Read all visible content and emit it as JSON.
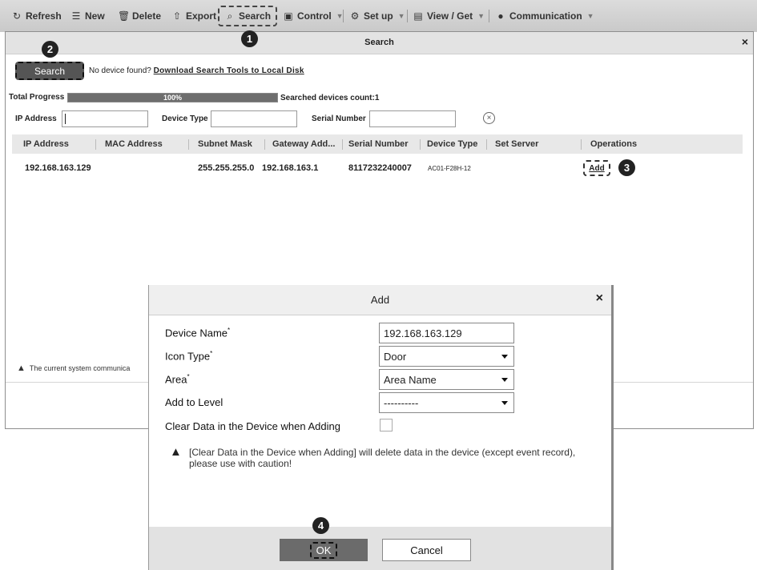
{
  "toolbar": {
    "refresh": "Refresh",
    "new": "New",
    "delete": "Delete",
    "export": "Export",
    "search": "Search",
    "control": "Control",
    "setup": "Set up",
    "view_get": "View / Get",
    "communication": "Communication"
  },
  "markers": [
    "1",
    "2",
    "3",
    "4"
  ],
  "search_window": {
    "title": "Search",
    "close": "×",
    "search_button": "Search",
    "no_device_text": "No device found?",
    "download_link": "Download Search Tools to Local Disk",
    "total_progress_label": "Total Progress",
    "progress_text": "100%",
    "progress_value": 1.0,
    "count_label": "Searched devices count:1",
    "filters": {
      "ip_label": "IP Address",
      "device_type_label": "Device Type",
      "serial_label": "Serial Number"
    },
    "columns": [
      "IP Address",
      "MAC Address",
      "Subnet Mask",
      "Gateway Add...",
      "Serial Number",
      "Device Type",
      "Set Server",
      "Operations"
    ],
    "row": {
      "ip": "192.168.163.129",
      "mac": "",
      "subnet": "255.255.255.0",
      "gateway": "192.168.163.1",
      "serial": "8117232240007",
      "device_type": "AC01-F28H-12",
      "set_server": "",
      "operation": "Add"
    },
    "status_warning": "The current system communica"
  },
  "add_dialog": {
    "title": "Add",
    "close": "×",
    "device_name_label": "Device Name",
    "device_name_value": "192.168.163.129",
    "icon_type_label": "Icon Type",
    "icon_type_value": "Door",
    "area_label": "Area",
    "area_value": "Area Name",
    "level_label": "Add to Level",
    "level_value": "----------",
    "clear_data_label": "Clear Data in the Device when Adding",
    "required_mark": "*",
    "warning": "[Clear Data in the Device when Adding] will delete data in the device (except event record), please use with caution!",
    "ok": "OK",
    "cancel": "Cancel"
  }
}
